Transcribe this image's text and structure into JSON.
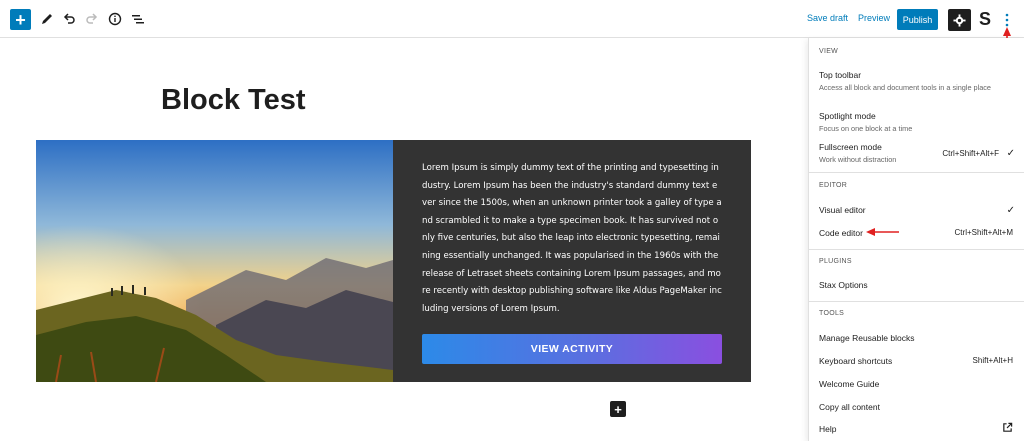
{
  "toolbar": {
    "save_draft": "Save draft",
    "preview": "Preview",
    "publish": "Publish",
    "stax_logo": "S",
    "icons": [
      "add-block-icon",
      "edit-icon",
      "undo-icon",
      "redo-icon",
      "info-icon",
      "list-view-icon",
      "gear-icon",
      "more-vertical-icon"
    ]
  },
  "post": {
    "title": "Block Test",
    "paragraph": "Lorem Ipsum is simply dummy text of the printing and typesetting industry. Lorem Ipsum has been the industry's standard dummy text ever since the 1500s, when an unknown printer took a galley of type and scrambled it to make a type specimen book. It has survived not only five centuries, but also the leap into electronic typesetting, remaining essentially unchanged. It was popularised in the 1960s with the release of Letraset sheets containing Lorem Ipsum passages, and more recently with desktop publishing software like Aldus PageMaker including versions of Lorem Ipsum.",
    "button_label": "VIEW ACTIVITY"
  },
  "menu": {
    "view": {
      "title": "VIEW",
      "top_toolbar": {
        "label": "Top toolbar",
        "help": "Access all block and document tools in a single place"
      },
      "spotlight": {
        "label": "Spotlight mode",
        "help": "Focus on one block at a time"
      },
      "fullscreen": {
        "label": "Fullscreen mode",
        "help": "Work without distraction",
        "shortcut": "Ctrl+Shift+Alt+F",
        "check": "✓"
      }
    },
    "editor": {
      "title": "EDITOR",
      "visual": {
        "label": "Visual editor",
        "check": "✓"
      },
      "code": {
        "label": "Code editor",
        "shortcut": "Ctrl+Shift+Alt+M"
      }
    },
    "plugins": {
      "title": "PLUGINS",
      "stax": {
        "label": "Stax Options"
      }
    },
    "tools": {
      "title": "TOOLS",
      "reusable": {
        "label": "Manage Reusable blocks"
      },
      "shortcuts": {
        "label": "Keyboard shortcuts",
        "shortcut": "Shift+Alt+H"
      },
      "welcome": {
        "label": "Welcome Guide"
      },
      "copy": {
        "label": "Copy all content"
      },
      "help": {
        "label": "Help"
      }
    }
  },
  "colors": {
    "accent": "#007cba",
    "annotation": "#e02020",
    "block_bg": "#333333"
  }
}
